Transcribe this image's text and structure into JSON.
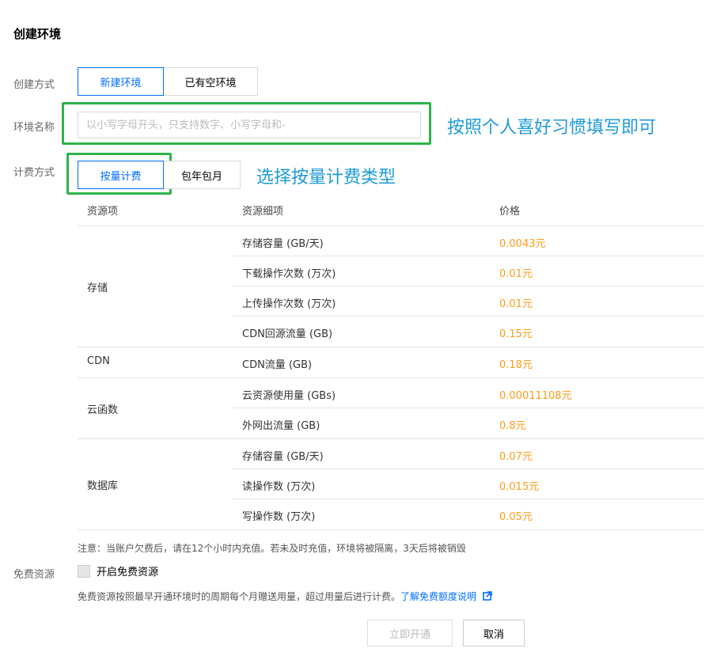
{
  "title": "创建环境",
  "create_mode": {
    "label": "创建方式",
    "options": [
      "新建环境",
      "已有空环境"
    ],
    "selected": 0
  },
  "env_name": {
    "label": "环境名称",
    "value": "",
    "placeholder": "以小写字母开头，只支持数字、小写字母和-"
  },
  "billing": {
    "label": "计费方式",
    "options": [
      "按量计费",
      "包年包月"
    ],
    "selected": 0
  },
  "annotations": {
    "name_hint": "按照个人喜好习惯填写即可",
    "billing_hint": "选择按量计费类型",
    "color": "#1d9bd8",
    "box_color": "#2db34a"
  },
  "pricing": {
    "headers": [
      "资源项",
      "资源细项",
      "价格"
    ],
    "groups": [
      {
        "name": "存储",
        "rows": [
          {
            "item": "存储容量 (GB/天)",
            "price": "0.0043元"
          },
          {
            "item": "下载操作次数 (万次)",
            "price": "0.01元"
          },
          {
            "item": "上传操作次数 (万次)",
            "price": "0.01元"
          },
          {
            "item": "CDN回源流量 (GB)",
            "price": "0.15元"
          }
        ]
      },
      {
        "name": "CDN",
        "rows": [
          {
            "item": "CDN流量 (GB)",
            "price": "0.18元"
          }
        ]
      },
      {
        "name": "云函数",
        "rows": [
          {
            "item": "云资源使用量 (GBs)",
            "price": "0.00011108元"
          },
          {
            "item": "外网出流量 (GB)",
            "price": "0.8元"
          }
        ]
      },
      {
        "name": "数据库",
        "rows": [
          {
            "item": "存储容量 (GB/天)",
            "price": "0.07元"
          },
          {
            "item": "读操作数 (万次)",
            "price": "0.015元"
          },
          {
            "item": "写操作数 (万次)",
            "price": "0.05元"
          }
        ]
      }
    ],
    "price_color": "#ff9c19"
  },
  "notice": "注意：当账户欠费后，请在12个小时内充值。若未及时充值，环境将被隔离，3天后将被销毁",
  "free_resource": {
    "label": "免费资源",
    "checkbox_label": "开启免费资源",
    "checked": false,
    "description": "免费资源按照最早开通环境时的周期每个月赠送用量，超过用量后进行计费。",
    "link_text": "了解免费额度说明",
    "link_icon": "external-link-icon"
  },
  "actions": {
    "submit": "立即开通",
    "cancel": "取消"
  },
  "accent_color": "#006eff"
}
